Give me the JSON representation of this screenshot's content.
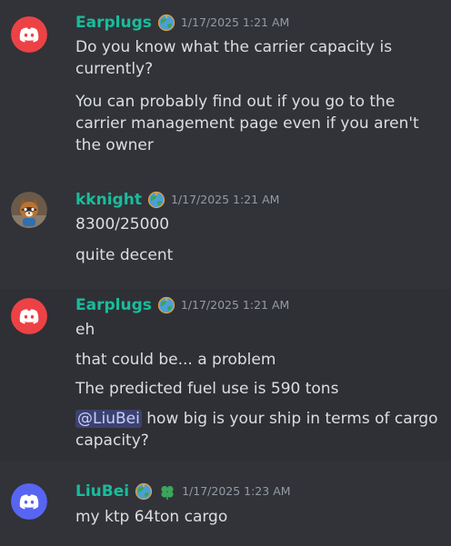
{
  "colors": {
    "background": "#313338",
    "hover_band": "#2e3035",
    "username": "#1abc9c",
    "text": "#dbdee1",
    "timestamp": "#949ba4",
    "mention_bg": "#3c4270",
    "mention_text": "#c9cdfb",
    "avatar_red": "#ed4245",
    "avatar_blurple": "#5865f2"
  },
  "messages": [
    {
      "username": "Earplugs",
      "timestamp": "1/17/2025 1:21 AM",
      "avatar_icon": "discord-logo-icon",
      "role_icon": "globe-icon",
      "lines": [
        "Do you know what the carrier capacity is currently?",
        "You can probably find out if you go to the carrier management page even if you aren't the owner"
      ]
    },
    {
      "username": "kknight",
      "timestamp": "1/17/2025 1:21 AM",
      "avatar_icon": "raccoon-avatar-icon",
      "role_icon": "globe-icon",
      "lines": [
        "8300/25000",
        "quite decent"
      ]
    },
    {
      "username": "Earplugs",
      "timestamp": "1/17/2025 1:21 AM",
      "avatar_icon": "discord-logo-icon",
      "role_icon": "globe-icon",
      "lines": [
        "eh",
        "that could be... a problem",
        "The predicted fuel use is 590 tons"
      ],
      "mention_line": {
        "mention": "@LiuBei",
        "text": " how big is your ship in terms of cargo capacity?"
      }
    },
    {
      "username": "LiuBei",
      "timestamp": "1/17/2025 1:23 AM",
      "avatar_icon": "discord-logo-icon",
      "role_icon": "globe-icon",
      "extra_icon": "clover-icon",
      "lines": [
        "my ktp 64ton cargo"
      ]
    }
  ]
}
